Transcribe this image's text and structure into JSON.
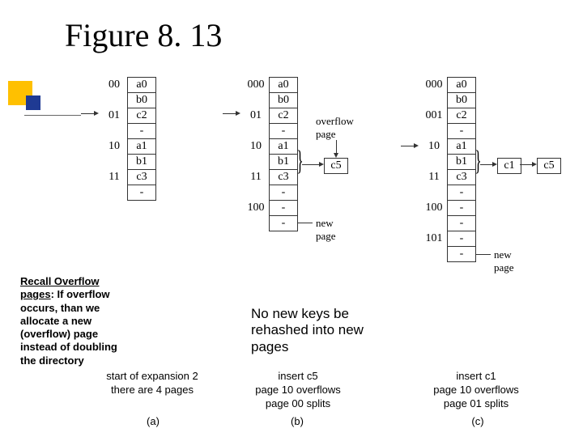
{
  "title": "Figure 8. 13",
  "recall": {
    "heading": "Recall Overflow pages",
    "body": ": If overflow occurs, than we allocate a new (overflow) page instead of doubling the directory"
  },
  "center_note": "No new keys be rehashed into new pages",
  "labels": {
    "overflow_page": "overflow page",
    "new_page": "new page"
  },
  "columns": {
    "a": {
      "rows": [
        {
          "idx": "00",
          "val": "a0"
        },
        {
          "idx": "",
          "val": "b0"
        },
        {
          "idx": "01",
          "val": "c2"
        },
        {
          "idx": "",
          "val": "-"
        },
        {
          "idx": "10",
          "val": "a1"
        },
        {
          "idx": "",
          "val": "b1"
        },
        {
          "idx": "11",
          "val": "c3"
        },
        {
          "idx": "",
          "val": "-"
        }
      ],
      "caption_line1": "start of expansion 2",
      "caption_line2": "there are 4 pages",
      "sub": "(a)"
    },
    "b": {
      "rows": [
        {
          "idx": "000",
          "val": "a0"
        },
        {
          "idx": "",
          "val": "b0"
        },
        {
          "idx": "01",
          "val": "c2"
        },
        {
          "idx": "",
          "val": "-"
        },
        {
          "idx": "10",
          "val": "a1"
        },
        {
          "idx": "",
          "val": "b1"
        },
        {
          "idx": "11",
          "val": "c3"
        },
        {
          "idx": "",
          "val": "-"
        },
        {
          "idx": "100",
          "val": "-"
        },
        {
          "idx": "",
          "val": "-"
        }
      ],
      "overflow": "c5",
      "caption_line1": "insert c5",
      "caption_line2": "page 10 overflows",
      "caption_line3": "page 00 splits",
      "sub": "(b)"
    },
    "c": {
      "rows": [
        {
          "idx": "000",
          "val": "a0"
        },
        {
          "idx": "",
          "val": "b0"
        },
        {
          "idx": "001",
          "val": "c2"
        },
        {
          "idx": "",
          "val": "-"
        },
        {
          "idx": "10",
          "val": "a1"
        },
        {
          "idx": "",
          "val": "b1"
        },
        {
          "idx": "11",
          "val": "c3"
        },
        {
          "idx": "",
          "val": "-"
        },
        {
          "idx": "100",
          "val": "-"
        },
        {
          "idx": "",
          "val": "-"
        },
        {
          "idx": "101",
          "val": "-"
        },
        {
          "idx": "",
          "val": "-"
        }
      ],
      "overflow1": "c1",
      "overflow2": "c5",
      "caption_line1": "insert c1",
      "caption_line2": "page 10 overflows",
      "caption_line3": "page 01 splits",
      "sub": "(c)"
    }
  }
}
